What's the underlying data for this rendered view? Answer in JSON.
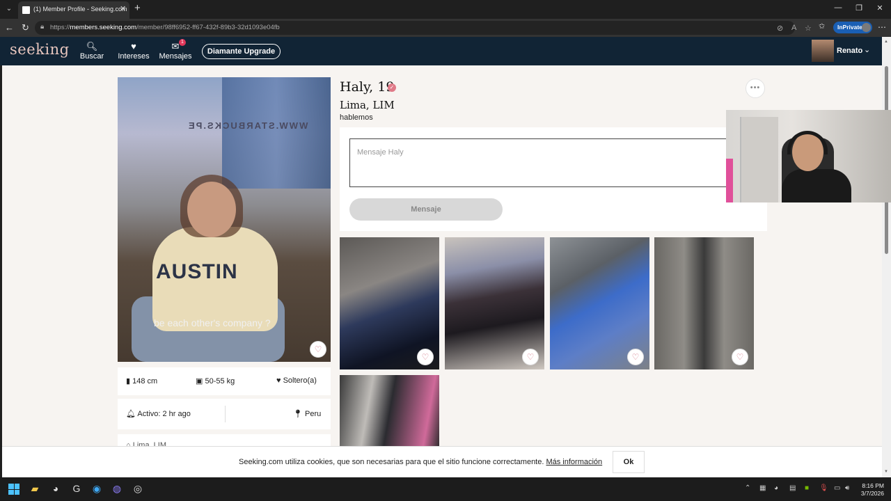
{
  "browser": {
    "tab_title": "(1) Member Profile - Seeking.com",
    "url_prefix": "https://",
    "url_host": "members.seeking.com",
    "url_path": "/member/98ff6952-ff67-432f-89b3-32d1093e04fb",
    "inprivate_label": "InPrivate"
  },
  "header": {
    "logo": "seeking",
    "nav": [
      {
        "label": "Buscar",
        "icon": "search-icon"
      },
      {
        "label": "Intereses",
        "icon": "heart-icon"
      },
      {
        "label": "Mensajes",
        "icon": "message-icon",
        "badge": "1"
      }
    ],
    "upgrade_label": "Diamante Upgrade",
    "user_name": "Renato"
  },
  "profile": {
    "name_age": "Haly, 19",
    "location": "Lima, LIM",
    "tagline": "hablemos",
    "photo_caption": "be each other's company ?",
    "photo_sign_text": "WWW.STARBUCKS.PE",
    "photo_sweater_text": "AUSTIN",
    "height": "148 cm",
    "weight": "50-55 kg",
    "relationship": "Soltero(a)",
    "active": "Activo: 2 hr ago",
    "country": "Peru",
    "partial_location": "Lima, LIM"
  },
  "message": {
    "placeholder": "Mensaje Haly",
    "button_label": "Mensaje"
  },
  "cookie": {
    "text": "Seeking.com utiliza cookies, que son necesarias para que el sitio funcione correctamente. ",
    "link": "Más información",
    "ok": "Ok"
  },
  "taskbar": {
    "time": "8:16 PM",
    "date": "3/7/2026"
  },
  "colors": {
    "header_bg": "#112435",
    "logo": "#e9c7bf",
    "page_bg": "#f7f4f1",
    "verified": "#e07a88",
    "badge": "#e0375a"
  }
}
